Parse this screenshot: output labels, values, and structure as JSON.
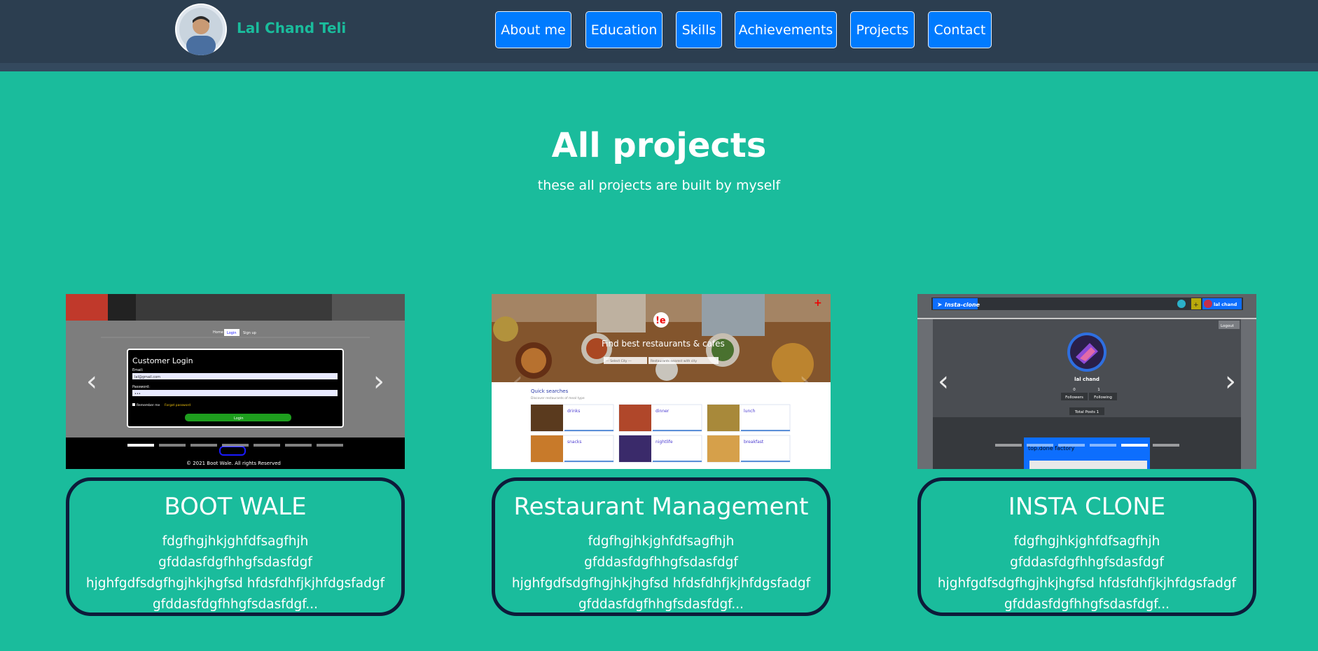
{
  "header": {
    "name": "Lal Chand Teli",
    "nav": [
      "About me",
      "Education",
      "Skills",
      "Achievements",
      "Projects",
      "Contact"
    ]
  },
  "hero": {
    "title": "All projects",
    "subtitle": "these all projects are built by myself"
  },
  "carousel": {
    "prev_glyph": "‹",
    "next_glyph": "›"
  },
  "projects": [
    {
      "title": "BOOT WALE",
      "description": "fdgfhgjhkjghfdfsagfhjh gfddasfdgfhhgfsdasfdgf hjghfgdfsdgfhgjhkjhgfsd hfdsfdhfjkjhfdgsfadgf gfddasfdgfhhgfsdasfdgf...",
      "screenshot_text": {
        "nav": [
          "Home",
          "Login",
          "Sign up"
        ],
        "form_title": "Customer Login",
        "email_label": "Email:",
        "email_value": "lal@gmail.com",
        "password_label": "Password:",
        "password_value": "•••",
        "remember": "Remember me",
        "forgot": "Forgot password",
        "login_button": "Login",
        "footer": "© 2021 Boot Wale. All rights Reserved"
      }
    },
    {
      "title": "Restaurant Management",
      "description": "fdgfhgjhkjghfdfsagfhjh gfddasfdgfhhgfsdasfdgf hjghfgdfsdgfhgjhkjhgfsd hfdsfdhfjkjhfdgsfadgf gfddasfdgfhhgfsdasfdgf...",
      "screenshot_text": {
        "logo": "!e",
        "tagline": "Find best restaurants & cafes",
        "city_select": "--- Select City ---",
        "search_placeholder": "Restaurants nearest with city",
        "section_title": "Quick searches",
        "section_sub": "Discover restaurants of meal type",
        "items": [
          "drinks",
          "dinner",
          "lunch",
          "snacks",
          "nightlife",
          "breakfast"
        ]
      }
    },
    {
      "title": "INSTA CLONE",
      "description": "fdgfhgjhkjghfdfsagfhjh gfddasfdgfhhgfsdasfdgf hjghfgdfsdgfhgjhkjhgfsd hfdsfdhfjkjhfdgsfadgf gfddasfdgfhhgfsdasfdgf...",
      "screenshot_text": {
        "brand": "Insta-clone",
        "user_chip": "lal chand",
        "logout": "Logout",
        "username": "lal chand",
        "followers_count": "0",
        "following_count": "1",
        "followers_label": "Followers",
        "following_label": "Following",
        "total_posts": "Total Posts 1",
        "post_caption": "top.done factory"
      }
    }
  ]
}
